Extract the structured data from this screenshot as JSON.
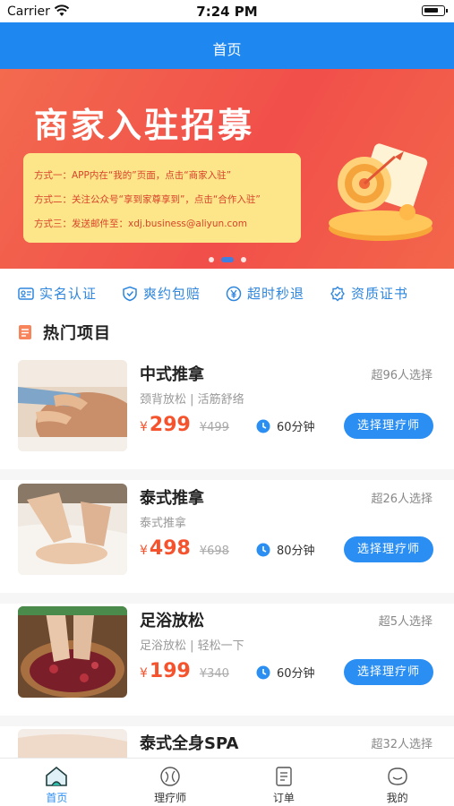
{
  "status_bar": {
    "carrier": "Carrier",
    "time": "7:24 PM"
  },
  "nav": {
    "title": "首页"
  },
  "banner": {
    "headline": "商家入驻招募",
    "lines": [
      "方式一：APP内在“我的”页面，点击“商家入驻”",
      "方式二：关注公众号“享到家尊享到”，点击“合作入驻”",
      "方式三：发送邮件至：xdj.business@aliyun.com"
    ],
    "page_count": 3,
    "active_page": 2
  },
  "features": [
    {
      "label": "实名认证",
      "icon": "id-card-icon"
    },
    {
      "label": "爽约包赔",
      "icon": "shield-icon"
    },
    {
      "label": "超时秒退",
      "icon": "yen-circle-icon"
    },
    {
      "label": "资质证书",
      "icon": "certificate-check-icon"
    }
  ],
  "section": {
    "title": "热门项目"
  },
  "items": [
    {
      "name": "中式推拿",
      "picks": "超96人选择",
      "desc": "颈背放松 | 活筋舒络",
      "yen": "¥",
      "price": "299",
      "old_price": "¥499",
      "duration": "60分钟",
      "button": "选择理疗师"
    },
    {
      "name": "泰式推拿",
      "picks": "超26人选择",
      "desc": "泰式推拿",
      "yen": "¥",
      "price": "498",
      "old_price": "¥698",
      "duration": "80分钟",
      "button": "选择理疗师"
    },
    {
      "name": "足浴放松",
      "picks": "超5人选择",
      "desc": "足浴放松 | 轻松一下",
      "yen": "¥",
      "price": "199",
      "old_price": "¥340",
      "duration": "60分钟",
      "button": "选择理疗师"
    },
    {
      "name": "泰式全身SPA",
      "picks": "超32人选择",
      "desc": "",
      "yen": "",
      "price": "",
      "old_price": "",
      "duration": "",
      "button": ""
    }
  ],
  "tabs": [
    {
      "label": "首页",
      "active": true,
      "icon": "home-icon"
    },
    {
      "label": "理疗师",
      "active": false,
      "icon": "therapist-icon"
    },
    {
      "label": "订单",
      "active": false,
      "icon": "order-icon"
    },
    {
      "label": "我的",
      "active": false,
      "icon": "profile-icon"
    }
  ],
  "colors": {
    "primary": "#1e88f0",
    "price": "#f5532d",
    "banner": "#f14f4a",
    "info_box": "#fde68a"
  }
}
